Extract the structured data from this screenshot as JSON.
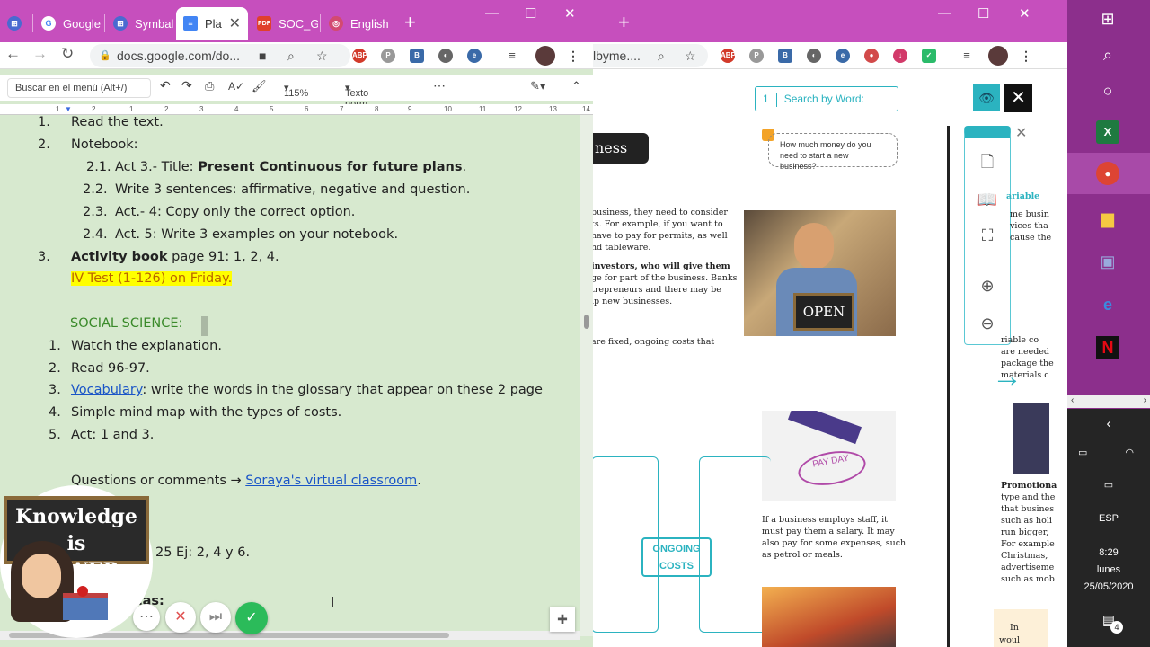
{
  "colors": {
    "chrome_tab_bar": "#c64fbd",
    "doc_background": "#d7e9cf",
    "highlight": "#ffff00",
    "accent_teal": "#2bb3c0",
    "taskbar": "#8c2f8c"
  },
  "left_window": {
    "tabs": [
      {
        "label": "",
        "icon": "apps-icon"
      },
      {
        "label": "Google",
        "icon": "google-icon"
      },
      {
        "label": "Symbal",
        "icon": "symbaloo-icon"
      },
      {
        "label": "Pla",
        "icon": "docs-icon",
        "active": true
      },
      {
        "label": "SOC_G",
        "icon": "pdf-icon"
      },
      {
        "label": "English",
        "icon": "web-icon"
      }
    ],
    "url": "docs.google.com/do...",
    "toolbar": {
      "menu_search": "Buscar en el menú (Alt+/)",
      "zoom": "115%",
      "style": "Texto norm..."
    },
    "ruler_ticks": [
      "1",
      "2",
      "1",
      "2",
      "3",
      "4",
      "5",
      "6",
      "7",
      "8",
      "9",
      "10",
      "11",
      "12",
      "13",
      "14",
      "15",
      "16"
    ],
    "doc": {
      "item1": {
        "num": "1.",
        "text": "Read the text."
      },
      "item2": {
        "num": "2.",
        "text": "Notebook:"
      },
      "sub1": {
        "num": "2.1.",
        "prefix": "Act 3.- Title: ",
        "bold": "Present Continuous for future plans",
        "suffix": "."
      },
      "sub2": {
        "num": "2.2.",
        "text": "Write 3 sentences: affirmative, negative and question."
      },
      "sub3": {
        "num": "2.3.",
        "text": "Act.- 4: Copy only the correct option."
      },
      "sub4": {
        "num": "2.4.",
        "text": "Act. 5: Write 3 examples on your notebook."
      },
      "item3": {
        "num": "3.",
        "bold": "Activity book",
        "text": " page 91: 1, 2, 4."
      },
      "test": "IV Test (1-126) on Friday.",
      "social_title": "SOCIAL SCIENCE:",
      "s1": {
        "num": "1.",
        "text": "Watch the explanation."
      },
      "s2": {
        "num": "2.",
        "text": "Read 96-97."
      },
      "s3": {
        "num": "3.",
        "link": "Vocabulary",
        "text": ": write the words in the glossary that appear on these 2 page"
      },
      "s4": {
        "num": "4.",
        "text": "Simple mind map with the types of costs."
      },
      "s5": {
        "num": "5.",
        "text": "Act: 1 and 3."
      },
      "questions_prefix": "Questions or comments → ",
      "questions_link": "Soraya's virtual classroom",
      "questions_suffix": ".",
      "partial_line": "25   Ej: 2, 4 y 6.",
      "partial_heading": "cas:"
    },
    "badge_text": "Knowledge is POWER"
  },
  "right_window": {
    "url": "lbyme....",
    "search_placeholder": "Search by Word:",
    "search_num": "1",
    "banner": "ness",
    "bubble": "How much money do you need to start a new business?",
    "text_block1": [
      "business, they need to consider",
      "ts. For example, if you want to",
      " have to pay for permits, as well",
      "nd tableware."
    ],
    "text_block2": [
      "investors, who will give them",
      "ge for part of the business. Banks",
      "trepreneurs and there may be",
      "lp new businesses."
    ],
    "text_fixed": "are fixed, ongoing costs that",
    "open_sign": "OPEN",
    "payday": "PAY DAY",
    "salary_text": [
      "If a business employs staff, it",
      "must pay them a salary. It may",
      "also pay for some expenses, such",
      "as petrol or meals."
    ],
    "ongoing_costs": "ONGOING COSTS",
    "variable_title": "ariable",
    "right_col": [
      "me busin",
      "vices tha",
      "cause the"
    ],
    "right_col2": [
      "riable co",
      "are needed",
      "package the",
      "materials c"
    ],
    "promotion": [
      "Promotiona",
      "type and the",
      "that busines",
      "such as holi",
      "run bigger,",
      "For example",
      "Christmas,",
      "advertiseme",
      "such as mob"
    ],
    "footer_partial": "In",
    "footer_partial2": "woul"
  },
  "taskbar": {
    "lang": "ESP",
    "time": "8:29",
    "day": "lunes",
    "date": "25/05/2020",
    "notifications": "4"
  }
}
